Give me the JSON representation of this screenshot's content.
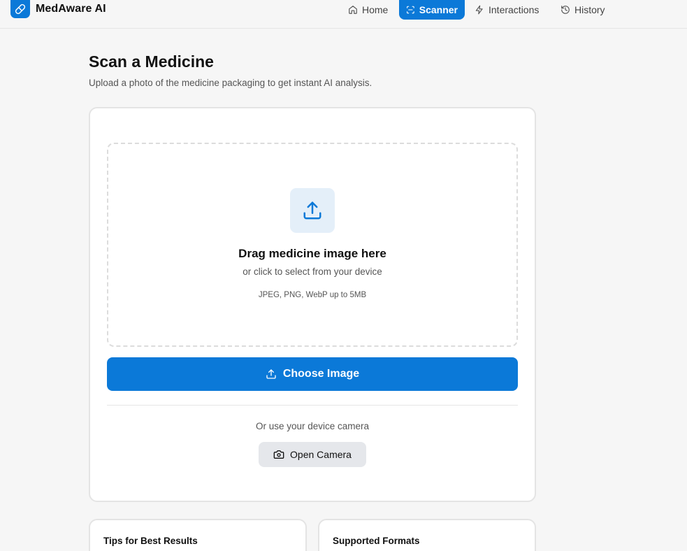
{
  "app": {
    "name": "MedAware AI",
    "logo_icon": "pill-icon",
    "accent": "#0b79d8"
  },
  "nav": {
    "items": [
      {
        "label": "Home",
        "icon": "home-icon",
        "active": false
      },
      {
        "label": "Scanner",
        "icon": "scan-icon",
        "active": true
      },
      {
        "label": "Interactions",
        "icon": "lightning-icon",
        "active": false
      },
      {
        "label": "History",
        "icon": "history-icon",
        "active": false
      }
    ]
  },
  "page": {
    "title": "Scan a Medicine",
    "subtitle": "Upload a photo of the medicine packaging to get instant AI analysis."
  },
  "upload": {
    "title": "Drag medicine image here",
    "subtitle": "or click to select from your device",
    "formats": "JPEG, PNG, WebP up to 5MB",
    "choose_label": "Choose Image",
    "camera_hint": "Or use your device camera",
    "camera_label": "Open Camera"
  },
  "cards": {
    "tips_title": "Tips for Best Results",
    "formats_title": "Supported Formats"
  }
}
